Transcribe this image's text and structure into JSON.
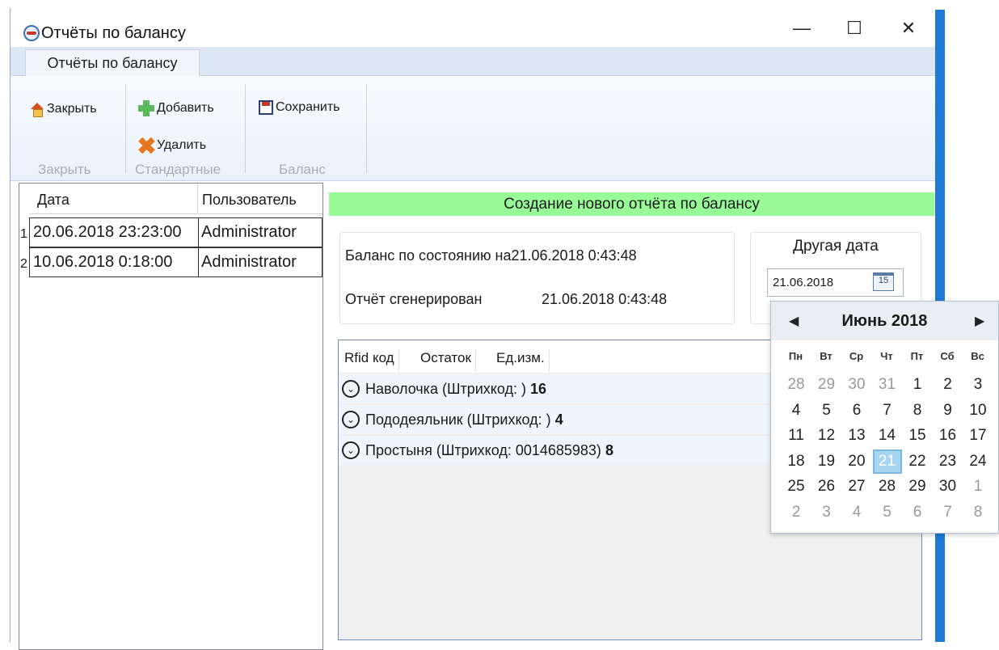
{
  "window": {
    "title": "Отчёты по балансу"
  },
  "window_controls": {
    "minimize": "—",
    "maximize": "☐",
    "close": "✕"
  },
  "tab": {
    "label": "Отчёты по балансу"
  },
  "ribbon": {
    "close_label": "Закрыть",
    "add_label": "Добавить",
    "delete_label": "Удалить",
    "save_label": "Сохранить",
    "groups": [
      "Закрыть",
      "Стандартные",
      "Баланс"
    ]
  },
  "reports_list": {
    "columns": [
      "Дата",
      "Пользователь"
    ],
    "rows": [
      {
        "num": "1",
        "date": "20.06.2018 23:23:00",
        "user": "Administrator"
      },
      {
        "num": "2",
        "date": "10.06.2018 0:18:00",
        "user": "Administrator"
      }
    ]
  },
  "banner": "Создание нового отчёта по балансу",
  "info": {
    "balance_label": "Баланс по состоянию на",
    "balance_value": "21.06.2018 0:43:48",
    "generated_label": "Отчёт сгенерирован",
    "generated_value": "21.06.2018 0:43:48"
  },
  "other_date": {
    "header": "Другая дата",
    "value": "21.06.2018",
    "calendar_icon_text": "15"
  },
  "items_tree": {
    "columns": [
      "Rfid код",
      "Остаток",
      "Ед.изм."
    ],
    "items": [
      {
        "name": "Наволочка (Штрихкод: )",
        "count": "16"
      },
      {
        "name": "Пододеяльник (Штрихкод: )",
        "count": "4"
      },
      {
        "name": "Простыня (Штрихкод: 0014685983)",
        "count": "8"
      }
    ]
  },
  "calendar": {
    "month_title": "Июнь 2018",
    "prev": "◀",
    "next": "▶",
    "weekdays": [
      "Пн",
      "Вт",
      "Ср",
      "Чт",
      "Пт",
      "Сб",
      "Вс"
    ],
    "weeks": [
      [
        "28",
        "29",
        "30",
        "31",
        "1",
        "2",
        "3"
      ],
      [
        "4",
        "5",
        "6",
        "7",
        "8",
        "9",
        "10"
      ],
      [
        "11",
        "12",
        "13",
        "14",
        "15",
        "16",
        "17"
      ],
      [
        "18",
        "19",
        "20",
        "21",
        "22",
        "23",
        "24"
      ],
      [
        "25",
        "26",
        "27",
        "28",
        "29",
        "30",
        "1"
      ],
      [
        "2",
        "3",
        "4",
        "5",
        "6",
        "7",
        "8"
      ]
    ],
    "selected": "21"
  }
}
